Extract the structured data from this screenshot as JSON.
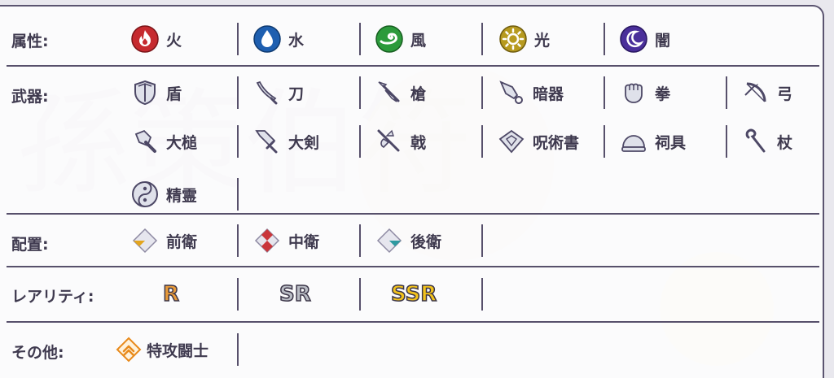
{
  "background": {
    "watermark": "孫策伯符"
  },
  "filters": {
    "attribute": {
      "label": "属性:",
      "items": [
        {
          "label": "火",
          "icon": "fire-icon",
          "color": "#c62a2f"
        },
        {
          "label": "水",
          "icon": "water-drop-icon",
          "color": "#1e5fb0"
        },
        {
          "label": "風",
          "icon": "wind-icon",
          "color": "#2c9a3b"
        },
        {
          "label": "光",
          "icon": "sun-icon",
          "color": "#b79a1f"
        },
        {
          "label": "闇",
          "icon": "moon-icon",
          "color": "#4a2f9a"
        }
      ]
    },
    "weapon": {
      "label": "武器:",
      "items": [
        {
          "label": "盾",
          "icon": "shield-icon"
        },
        {
          "label": "刀",
          "icon": "katana-icon"
        },
        {
          "label": "槍",
          "icon": "spear-icon"
        },
        {
          "label": "暗器",
          "icon": "hidden-weapon-icon"
        },
        {
          "label": "拳",
          "icon": "fist-icon"
        },
        {
          "label": "弓",
          "icon": "bow-icon"
        },
        {
          "label": "大槌",
          "icon": "hammer-icon"
        },
        {
          "label": "大剣",
          "icon": "greatsword-icon"
        },
        {
          "label": "戟",
          "icon": "halberd-icon"
        },
        {
          "label": "呪術書",
          "icon": "spellbook-icon"
        },
        {
          "label": "祠具",
          "icon": "ritual-tool-icon"
        },
        {
          "label": "杖",
          "icon": "staff-icon"
        },
        {
          "label": "精霊",
          "icon": "spirit-icon"
        }
      ]
    },
    "position": {
      "label": "配置:",
      "items": [
        {
          "label": "前衛",
          "icon": "vanguard-icon",
          "color": "#e3a51e"
        },
        {
          "label": "中衛",
          "icon": "midguard-icon",
          "color": "#c9363b"
        },
        {
          "label": "後衛",
          "icon": "rearguard-icon",
          "color": "#2e9aa0"
        }
      ]
    },
    "rarity": {
      "label": "レアリティ:",
      "items": [
        {
          "label": "R",
          "color": "#e79a3a"
        },
        {
          "label": "SR",
          "color": "#b9bcc4"
        },
        {
          "label": "SSR",
          "color": "#f2c21c"
        }
      ]
    },
    "other": {
      "label": "その他:",
      "items": [
        {
          "label": "特攻闘士",
          "icon": "special-attack-icon",
          "color": "#e88a1c"
        }
      ]
    }
  }
}
